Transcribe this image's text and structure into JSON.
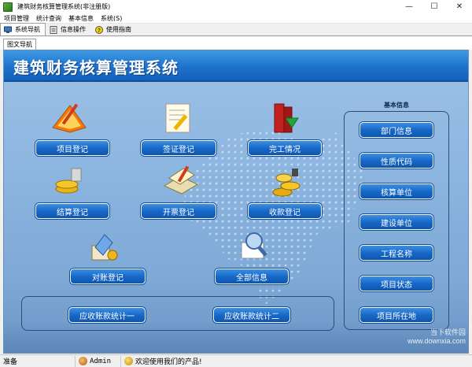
{
  "window": {
    "title": "建筑财务核算管理系统(非注册版)",
    "controls": [
      "—",
      "☐",
      "✕"
    ]
  },
  "menu": [
    "项目管理",
    "统计查询",
    "基本信息",
    "系统(S)"
  ],
  "toolbar_tabs": [
    "系统导航",
    "信息操作",
    "使用指南"
  ],
  "sub_tab": "图文导航",
  "header": {
    "title": "建筑财务核算管理系统"
  },
  "main_buttons": {
    "project_register": "项目登记",
    "visa_register": "签证登记",
    "completion": "完工情况",
    "settlement_register": "结算登记",
    "invoice_register": "开票登记",
    "payment_register": "收款登记",
    "reconcile_register": "对账登记",
    "all_info": "全部信息",
    "receivable_stat1": "应收账款统计一",
    "receivable_stat2": "应收账款统计二"
  },
  "side_panel": {
    "title": "基本信息",
    "items": [
      "部门信息",
      "性质代码",
      "核算单位",
      "建设单位",
      "工程名称",
      "项目状态",
      "项目所在地"
    ]
  },
  "statusbar": {
    "ready": "准备",
    "user": "Admin",
    "welcome": "欢迎使用我们的产品!"
  },
  "watermark": {
    "line1": "当下软件园",
    "line2": "www.downxia.com"
  },
  "colors": {
    "header_blue": "#1e72cc",
    "button_blue": "#1868c8",
    "panel_bg": "#8cb5e0"
  }
}
